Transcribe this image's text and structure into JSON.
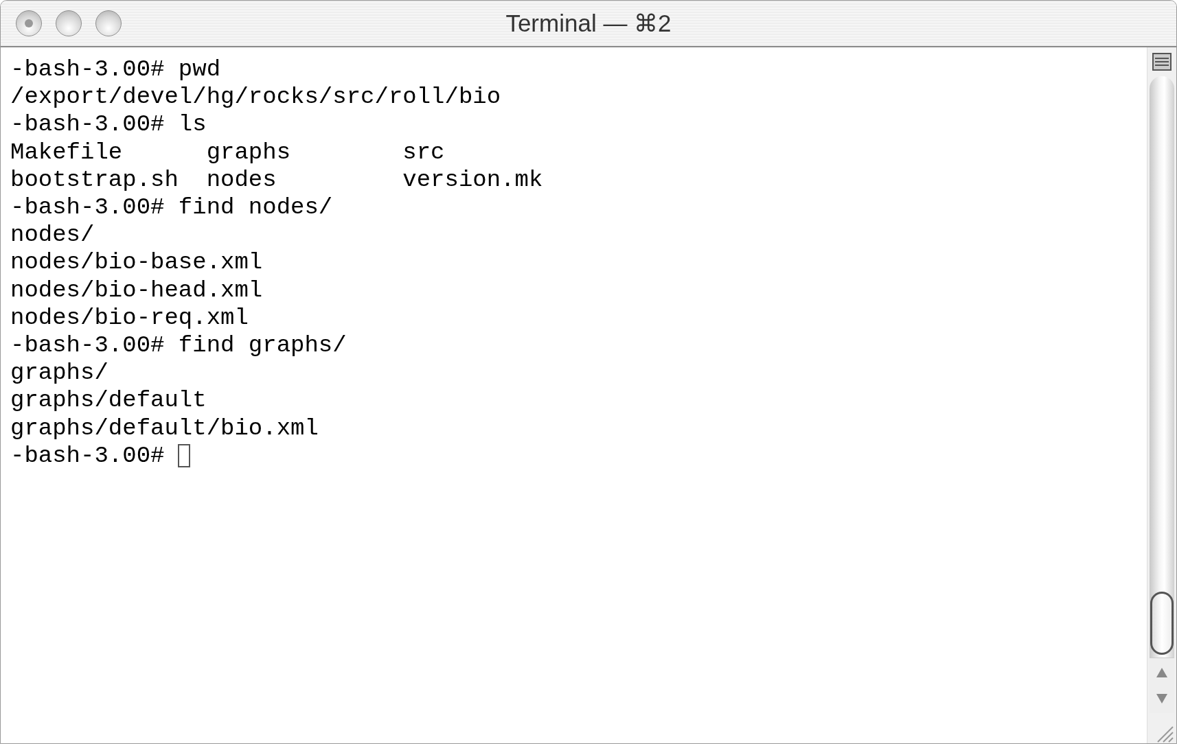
{
  "window": {
    "title": "Terminal — ⌘2"
  },
  "terminal": {
    "lines": [
      "-bash-3.00# pwd",
      "/export/devel/hg/rocks/src/roll/bio",
      "-bash-3.00# ls",
      "Makefile      graphs        src",
      "bootstrap.sh  nodes         version.mk",
      "-bash-3.00# find nodes/",
      "nodes/",
      "nodes/bio-base.xml",
      "nodes/bio-head.xml",
      "nodes/bio-req.xml",
      "-bash-3.00# find graphs/",
      "graphs/",
      "graphs/default",
      "graphs/default/bio.xml"
    ],
    "prompt": "-bash-3.00#"
  }
}
